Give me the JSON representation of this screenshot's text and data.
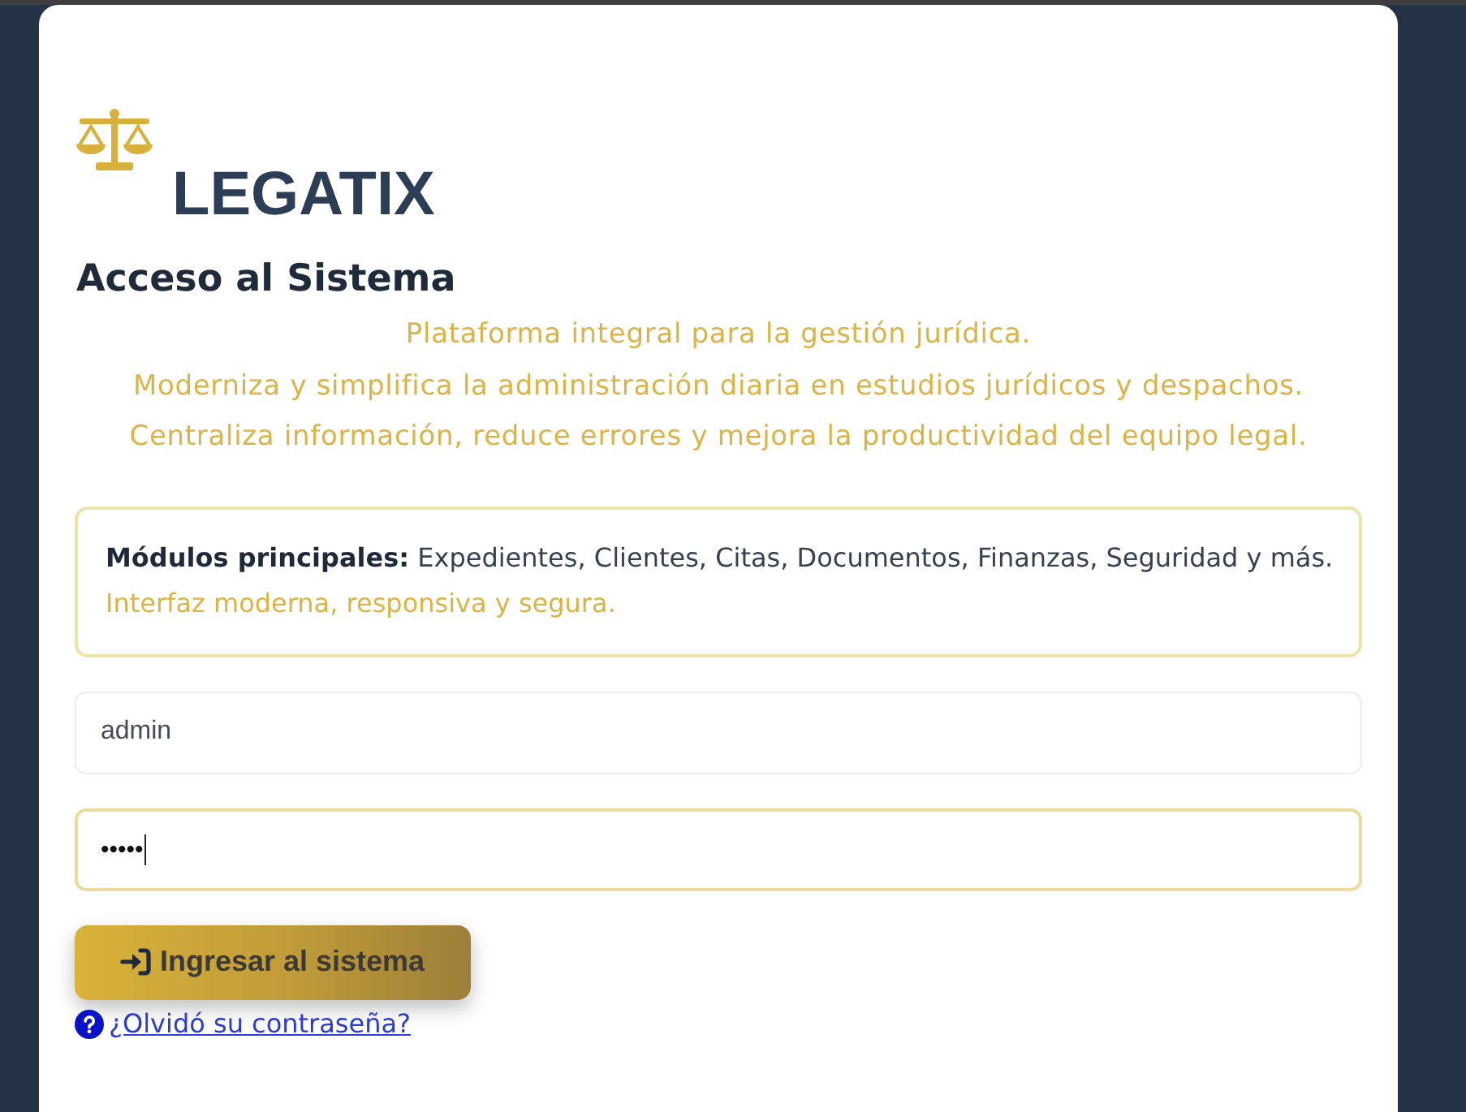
{
  "brand": {
    "name": "LEGATIX"
  },
  "heading": "Acceso al Sistema",
  "tagline": [
    "Plataforma integral para la gestión jurídica.",
    "Moderniza y simplifica la administración diaria en estudios jurídicos y despachos.",
    "Centraliza información, reduce errores y mejora la productividad del equipo legal."
  ],
  "modules_box": {
    "text": "**Módulos principales:** Expedientes, Clientes, Citas, Documentos, Finanzas, Seguridad y más.",
    "note": "Interfaz moderna, responsiva y segura."
  },
  "fields": [
    {
      "kind": "username",
      "value": "admin",
      "focused": false
    },
    {
      "kind": "password",
      "value": "•••••",
      "focused": true
    }
  ],
  "submit_button": {
    "label": "Ingresar al sistema"
  },
  "forgot_link": {
    "label": "¿Olvidó su contraseña?"
  }
}
